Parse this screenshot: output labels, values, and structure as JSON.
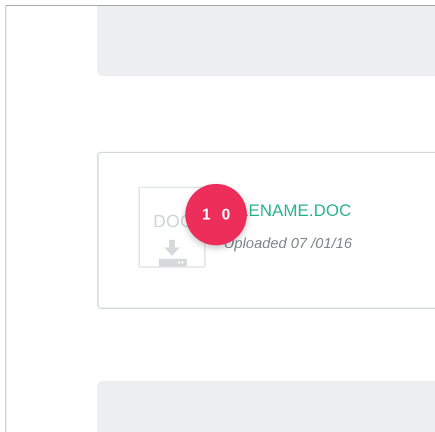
{
  "file": {
    "type_label": "DOC",
    "name": "FILENAME.DOC",
    "uploaded": "Uploaded 07 /01/16",
    "action_icon": "download-icon"
  },
  "badge": {
    "number": "1 0",
    "color": "#ed2e5a"
  },
  "colors": {
    "accent": "#2cb48e",
    "panel": "#eceeef",
    "card_border": "#d7dbdd"
  }
}
